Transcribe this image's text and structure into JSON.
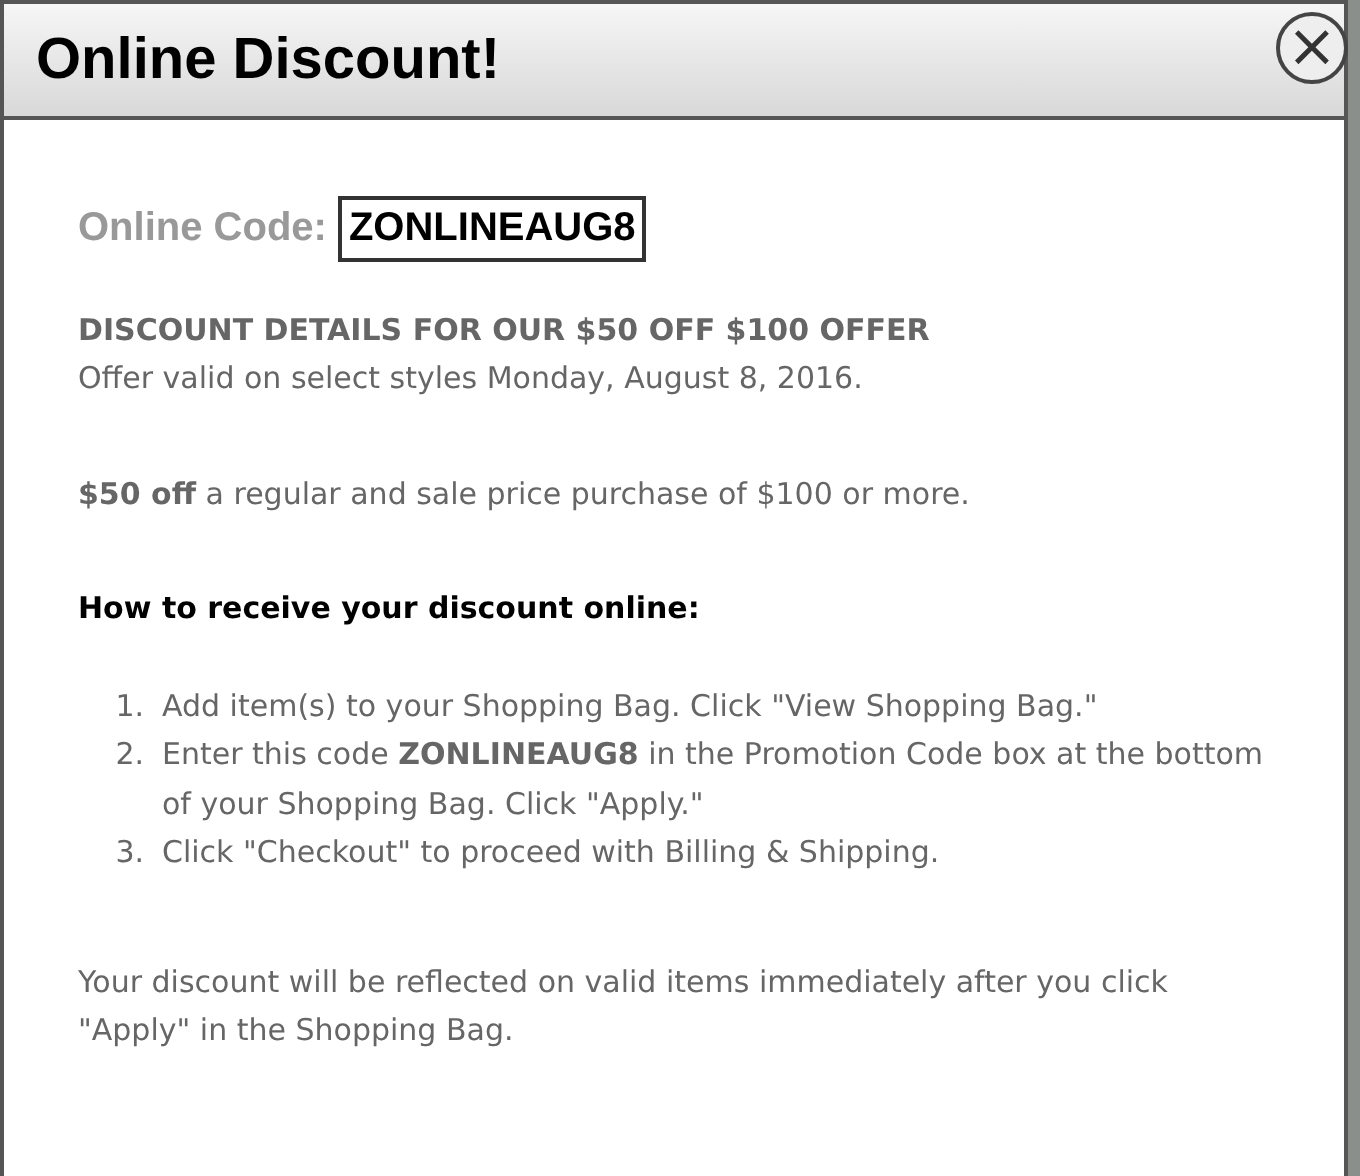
{
  "dialog": {
    "title": "Online Discount!",
    "close_icon": "×"
  },
  "code": {
    "label": "Online Code:",
    "value": "ZONLINEAUG8"
  },
  "details": {
    "heading": "DISCOUNT DETAILS FOR OUR $50 OFF $100 OFFER",
    "validity": "Offer valid on select styles Monday, August 8, 2016."
  },
  "offer": "**$50 off** a regular and sale price purchase of $100 or more.",
  "instructions": {
    "heading": "How to receive your discount online:",
    "steps": [
      {
        "number": "1.",
        "text": "Add item(s) to your Shopping Bag. Click \"View Shopping Bag.\""
      },
      {
        "number": "2.",
        "text": "Enter this code **ZONLINEAUG8** in the Promotion Code box at the bottom of your Shopping Bag. Click \"Apply.\""
      },
      {
        "number": "3.",
        "text": "Click \"Checkout\" to proceed with Billing & Shipping."
      }
    ]
  },
  "note": "Your discount will be reflected on valid items immediately after you click \"Apply\" in the Shopping Bag."
}
